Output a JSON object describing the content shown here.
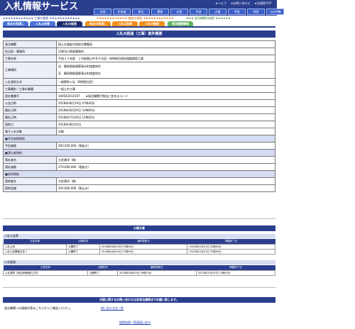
{
  "header": {
    "logo": "入札情報サービス",
    "top_links": [
      "★ヘルプ",
      "★お問い合わせ",
      "★全国版TOP"
    ],
    "regions": [
      "全国",
      "北海道",
      "東北",
      "関東",
      "北陸",
      "中部",
      "近畿",
      "中国",
      "四国",
      "九州沖縄"
    ]
  },
  "sections": {
    "construction": "★★★★★★★★★★★★ 工事の検索 ★★★★★★★★★★★★",
    "services": "★★★★★★★★★★★★ 業務の検索 ★★★★★★★★★★★★",
    "other": "★★★ 発注機関の検索 ★★★★★★"
  },
  "tabs": [
    "発注の見通し",
    "入札公告等",
    "入札の経過",
    "発注の見通し",
    "入札公告等",
    "入札の経過",
    "発注機関情報"
  ],
  "main_title": "入札の経過（工事）案件概要",
  "rows": [
    {
      "k": "発注機関",
      "v": "国土交通省中部地方整備局"
    },
    {
      "k": "担当部・事務所",
      "v": "沼津河川国道事務所"
    },
    {
      "k": "工事名称",
      "v": "平成３０年度　１号駿東山中ＢＰ谷田・笹原新田改良道路建設工事"
    },
    {
      "k": "工事場所",
      "v": "自　静岡県駿東郡清水町徳倉地先",
      "v2": "至　静岡県駿東郡清水町徳倉地先"
    },
    {
      "k": "入札契約方式",
      "v": "一般競争入札（同時提出型）"
    },
    {
      "k": "工事種別／工事の業種",
      "v": "一般土木工事"
    },
    {
      "k": "設計書番号",
      "v": "100542411047　　★発注機関が独自に定めるコード"
    },
    {
      "k": "公告日時",
      "v": "2018年06月19日 07時30分"
    },
    {
      "k": "開札日時",
      "v": "2018年06月29日 10時00分"
    },
    {
      "k": "開札日時",
      "v": "2018年07月26日 11時02分"
    },
    {
      "k": "契約日",
      "v": "2018年08月03日"
    },
    {
      "k": "電子入札対象",
      "v": "対象"
    }
  ],
  "sec_estimate": {
    "title": "■予定価格情報",
    "k": "予定価格",
    "v": "283,500,000（税抜き）"
  },
  "sec_bid": {
    "title": "■落札者情報",
    "k1": "落札者名",
    "v1": "大佐建洋（株）",
    "k2": "落札価格",
    "v2": "270,000,000（税抜き）"
  },
  "sec_contract": {
    "title": "■契約情報",
    "k1": "契約者名",
    "v1": "大佐建洋（株）",
    "k2": "契約金額",
    "v2": "291,600,000（税込み）"
  },
  "public_docs": {
    "title": "公開文書",
    "group1": "入札公告等",
    "headers": [
      "文書名称",
      "公開状況",
      "最終更新日",
      "掲載終了日"
    ],
    "rows1": [
      [
        "入札公告",
        "公開終了",
        "2018年06月19日 07時00分",
        "2020年01月31日 23時00分"
      ],
      [
        "入札公告関連文書 1",
        "公開終了",
        "2018年06月19日 07時00分",
        "2020年01月31日 23時00分"
      ]
    ],
    "group2": "入札経過",
    "rows2": [
      [
        "入札調書（総合評価落札方式）",
        "公開終了",
        "2018年08月03日 09時15分",
        "2020年01月31日 23時00分"
      ]
    ]
  },
  "contact": {
    "bar": "内容に関するお問い合わせは各発注機関までお願い致します。",
    "text": "発注機関への連絡先等はこちらからご確認ください。",
    "link": "問い合わせ先一覧",
    "back": "検索結果一覧画面に戻る"
  }
}
